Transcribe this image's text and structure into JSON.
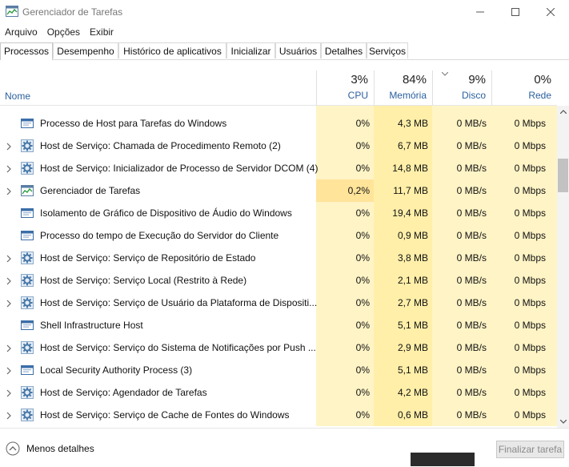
{
  "window": {
    "title": "Gerenciador de Tarefas"
  },
  "menu": [
    "Arquivo",
    "Opções",
    "Exibir"
  ],
  "tabs": [
    {
      "label": "Processos"
    },
    {
      "label": "Desempenho"
    },
    {
      "label": "Histórico de aplicativos"
    },
    {
      "label": "Inicializar"
    },
    {
      "label": "Usuários"
    },
    {
      "label": "Detalhes"
    },
    {
      "label": "Serviços"
    }
  ],
  "active_tab": "Processos",
  "columns": {
    "name": "Nome",
    "cpu": {
      "pct": "3%",
      "label": "CPU"
    },
    "memory": {
      "pct": "84%",
      "label": "Memória"
    },
    "disk": {
      "pct": "9%",
      "label": "Disco"
    },
    "network": {
      "pct": "0%",
      "label": "Rede"
    }
  },
  "rows": [
    {
      "name": "Processo de Host para Tarefas do Windows",
      "cpu": "0%",
      "mem": "4,3 MB",
      "disk": "0 MB/s",
      "net": "0 Mbps",
      "expand": false,
      "icon": "window-icon"
    },
    {
      "name": "Host de Serviço: Chamada de Procedimento Remoto (2)",
      "cpu": "0%",
      "mem": "6,7 MB",
      "disk": "0 MB/s",
      "net": "0 Mbps",
      "expand": true,
      "icon": "gear-icon"
    },
    {
      "name": "Host de Serviço: Inicializador de Processo de Servidor DCOM (4)",
      "cpu": "0%",
      "mem": "14,8 MB",
      "disk": "0 MB/s",
      "net": "0 Mbps",
      "expand": true,
      "icon": "gear-icon"
    },
    {
      "name": "Gerenciador de Tarefas",
      "cpu": "0,2%",
      "mem": "11,7 MB",
      "disk": "0 MB/s",
      "net": "0 Mbps",
      "expand": true,
      "icon": "task-manager-icon",
      "cpu_highlight": true
    },
    {
      "name": "Isolamento de Gráfico de Dispositivo de Áudio do Windows",
      "cpu": "0%",
      "mem": "19,4 MB",
      "disk": "0 MB/s",
      "net": "0 Mbps",
      "expand": false,
      "icon": "window-icon"
    },
    {
      "name": "Processo do tempo de Execução do Servidor do Cliente",
      "cpu": "0%",
      "mem": "0,9 MB",
      "disk": "0 MB/s",
      "net": "0 Mbps",
      "expand": false,
      "icon": "window-icon"
    },
    {
      "name": "Host de Serviço: Serviço de Repositório de Estado",
      "cpu": "0%",
      "mem": "3,8 MB",
      "disk": "0 MB/s",
      "net": "0 Mbps",
      "expand": true,
      "icon": "gear-icon"
    },
    {
      "name": "Host de Serviço: Serviço Local (Restrito à Rede)",
      "cpu": "0%",
      "mem": "2,1 MB",
      "disk": "0 MB/s",
      "net": "0 Mbps",
      "expand": true,
      "icon": "gear-icon"
    },
    {
      "name": "Host de Serviço: Serviço de Usuário da Plataforma de Dispositi...",
      "cpu": "0%",
      "mem": "2,7 MB",
      "disk": "0 MB/s",
      "net": "0 Mbps",
      "expand": true,
      "icon": "gear-icon"
    },
    {
      "name": "Shell Infrastructure Host",
      "cpu": "0%",
      "mem": "5,1 MB",
      "disk": "0 MB/s",
      "net": "0 Mbps",
      "expand": false,
      "icon": "window-icon"
    },
    {
      "name": "Host de Serviço: Serviço do Sistema de Notificações por Push ...",
      "cpu": "0%",
      "mem": "2,9 MB",
      "disk": "0 MB/s",
      "net": "0 Mbps",
      "expand": true,
      "icon": "gear-icon"
    },
    {
      "name": "Local Security Authority Process (3)",
      "cpu": "0%",
      "mem": "5,1 MB",
      "disk": "0 MB/s",
      "net": "0 Mbps",
      "expand": true,
      "icon": "window-icon"
    },
    {
      "name": "Host de Serviço: Agendador de Tarefas",
      "cpu": "0%",
      "mem": "4,2 MB",
      "disk": "0 MB/s",
      "net": "0 Mbps",
      "expand": true,
      "icon": "gear-icon"
    },
    {
      "name": "Host de Serviço: Serviço de Cache de Fontes do Windows",
      "cpu": "0%",
      "mem": "0,6 MB",
      "disk": "0 MB/s",
      "net": "0 Mbps",
      "expand": true,
      "icon": "gear-icon"
    }
  ],
  "footer": {
    "fewer_details": "Menos detalhes",
    "end_task": "Finalizar tarefa"
  }
}
